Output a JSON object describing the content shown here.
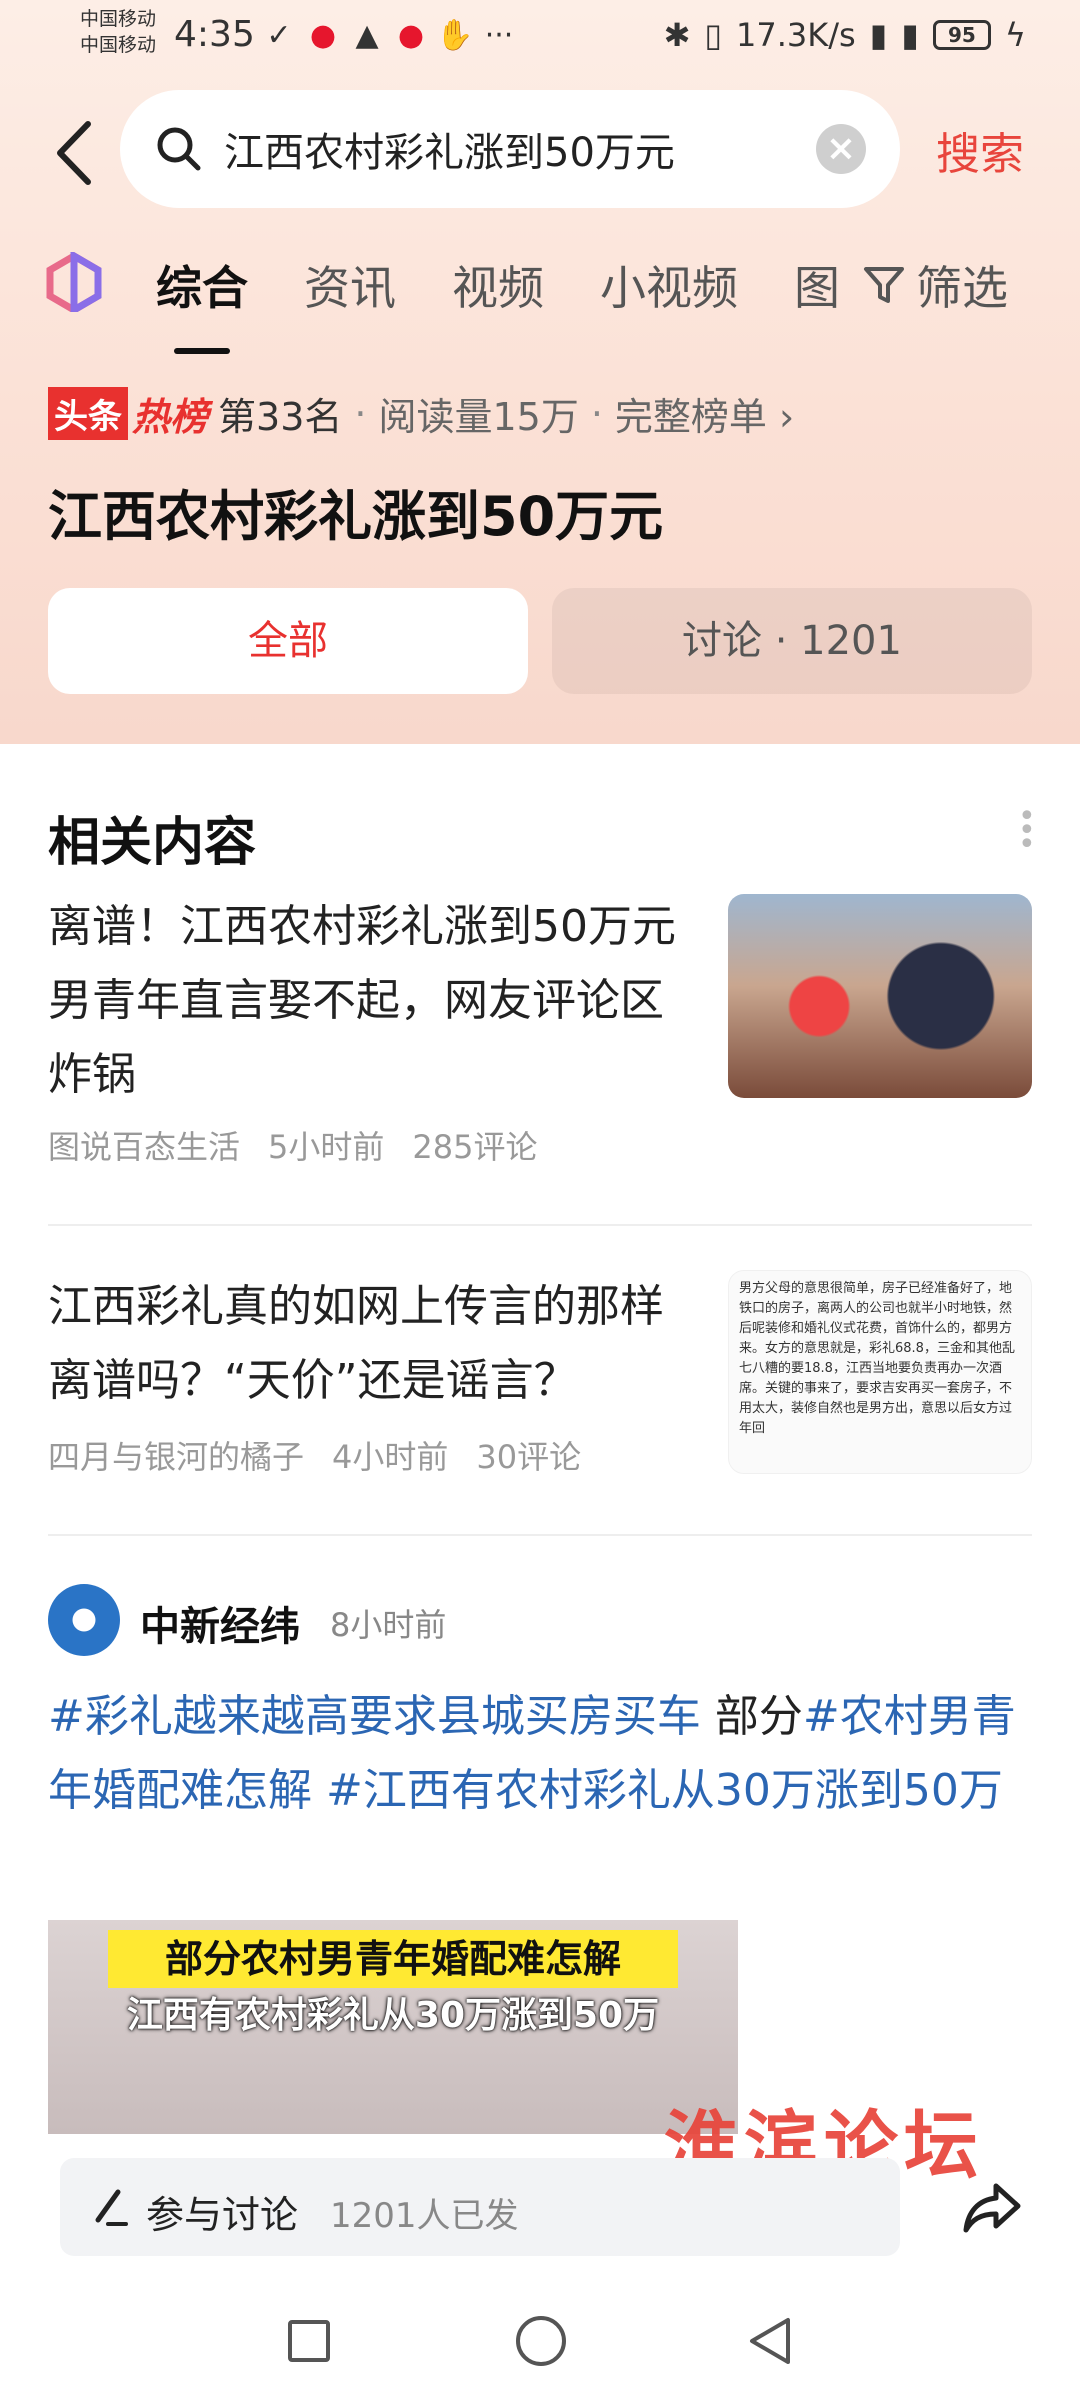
{
  "status_bar": {
    "carrier1": "中国移动",
    "carrier2": "中国移动",
    "time": "4:35",
    "speed": "17.3K/s",
    "battery": "95",
    "more": "···"
  },
  "search": {
    "query": "江西农村彩礼涨到50万元",
    "button_label": "搜索"
  },
  "tabs": [
    "综合",
    "资讯",
    "视频",
    "小视频",
    "图"
  ],
  "filter_label": "筛选",
  "hot": {
    "badge_part1": "头条",
    "badge_part2": "热榜",
    "rank": "第33名",
    "reads": "阅读量15万",
    "full_list": "完整榜单 ›",
    "title": "江西农村彩礼涨到50万元"
  },
  "segments": {
    "all": "全部",
    "discussion": "讨论 · 1201"
  },
  "related": {
    "heading": "相关内容",
    "articles": [
      {
        "title": "离谱！江西农村彩礼涨到50万元 男青年直言娶不起，网友评论区炸锅",
        "source": "图说百态生活",
        "time": "5小时前",
        "comments": "285评论"
      },
      {
        "title": "江西彩礼真的如网上传言的那样离谱吗？“天价”还是谣言？",
        "source": "四月与银河的橘子",
        "time": "4小时前",
        "comments": "30评论",
        "thumb_text": "男方父母的意思很简单，房子已经准备好了，地铁口的房子，离两人的公司也就半小时地铁，然后呢装修和婚礼仪式花费，首饰什么的，都男方来。女方的意思就是，彩礼68.8，三金和其他乱七八糟的要18.8，江西当地要负责再办一次酒席。关键的事来了，要求吉安再买一套房子，不用太大，装修自然也是男方出，意思以后女方过年回"
      }
    ]
  },
  "post": {
    "author": "中新经纬",
    "time": "8小时前",
    "tag1": "#彩礼越来越高要求县城买房买车",
    "text1": " 部分",
    "tag2": "#农村男青年婚配难怎解",
    "text2": " ",
    "tag3": "#江西有农村彩礼从30万涨到50万",
    "image_band1": "部分农村男青年婚配难怎解",
    "image_band2": "江西有农村彩礼从30万涨到50万"
  },
  "watermark": "淮滨论坛",
  "bottom": {
    "discuss_label": "参与讨论",
    "discuss_count": "1201人已发"
  },
  "colors": {
    "accent": "#e8312f",
    "tag": "#2b66b3"
  }
}
